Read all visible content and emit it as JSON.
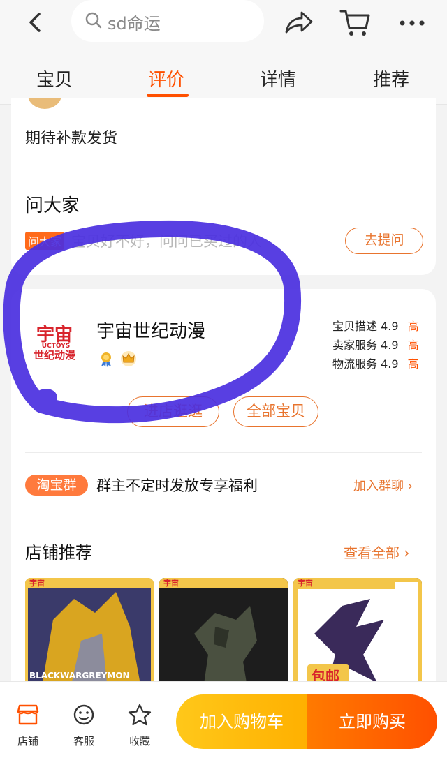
{
  "header": {
    "search_text": "sd命运",
    "tabs": [
      {
        "label": "宝贝"
      },
      {
        "label": "评价"
      },
      {
        "label": "详情"
      },
      {
        "label": "推荐"
      }
    ],
    "active_tab": "评价"
  },
  "review": {
    "text": "期待补款发货"
  },
  "qa": {
    "title": "问大家",
    "tag": "问大家",
    "hint": "宝贝好不好，问问已买过的人",
    "ask_button": "去提问"
  },
  "shop": {
    "logo_text_top": "宇宙",
    "logo_text_mid": "UCTOYS",
    "logo_text_bottom": "世纪动漫",
    "name": "宇宙世纪动漫",
    "badges": [
      "medal-icon",
      "crown-icon"
    ],
    "scores": [
      {
        "label": "宝贝描述",
        "value": "4.9",
        "level": "高"
      },
      {
        "label": "卖家服务",
        "value": "4.9",
        "level": "高"
      },
      {
        "label": "物流服务",
        "value": "4.9",
        "level": "高"
      }
    ],
    "visit_button": "进店逛逛",
    "all_items_button": "全部宝贝"
  },
  "group": {
    "tag": "淘宝群",
    "text": "群主不定时发放专享福利",
    "join": "加入群聊 ›"
  },
  "recommend": {
    "title": "店铺推荐",
    "view_all": "查看全部 ›",
    "items": [
      {
        "caption": "BLACKWARGREYMON"
      },
      {
        "caption": ""
      },
      {
        "caption": "包邮"
      }
    ]
  },
  "bottom": {
    "nav": [
      {
        "label": "店铺",
        "icon": "shop-icon"
      },
      {
        "label": "客服",
        "icon": "service-icon"
      },
      {
        "label": "收藏",
        "icon": "star-icon"
      }
    ],
    "add_to_cart": "加入购物车",
    "buy_now": "立即购买"
  },
  "colors": {
    "accent": "#ff5000",
    "annotation": "#4a2fe0",
    "cart_yellow": "#ffb000"
  }
}
